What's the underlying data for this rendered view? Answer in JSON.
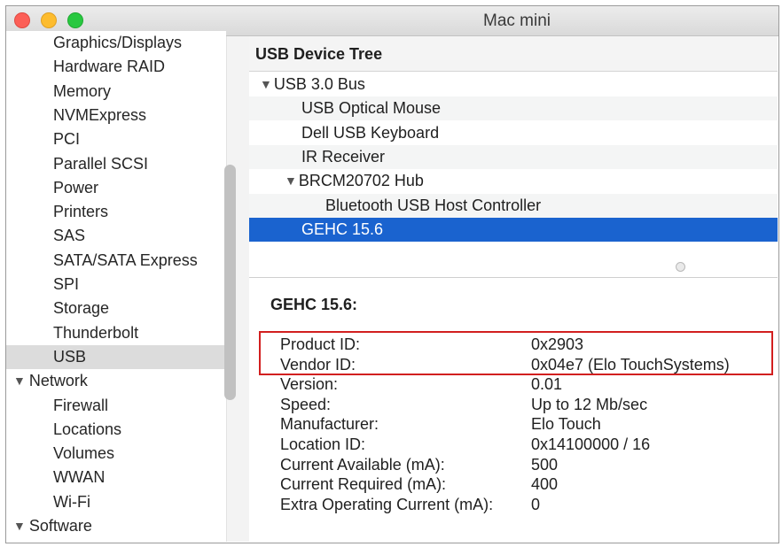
{
  "window": {
    "title": "Mac mini"
  },
  "sidebar": {
    "items": [
      {
        "label": "Graphics/Displays",
        "kind": "child"
      },
      {
        "label": "Hardware RAID",
        "kind": "child"
      },
      {
        "label": "Memory",
        "kind": "child"
      },
      {
        "label": "NVMExpress",
        "kind": "child"
      },
      {
        "label": "PCI",
        "kind": "child"
      },
      {
        "label": "Parallel SCSI",
        "kind": "child"
      },
      {
        "label": "Power",
        "kind": "child"
      },
      {
        "label": "Printers",
        "kind": "child"
      },
      {
        "label": "SAS",
        "kind": "child"
      },
      {
        "label": "SATA/SATA Express",
        "kind": "child"
      },
      {
        "label": "SPI",
        "kind": "child"
      },
      {
        "label": "Storage",
        "kind": "child"
      },
      {
        "label": "Thunderbolt",
        "kind": "child"
      },
      {
        "label": "USB",
        "kind": "child",
        "selected": true
      },
      {
        "label": "Network",
        "kind": "group"
      },
      {
        "label": "Firewall",
        "kind": "child"
      },
      {
        "label": "Locations",
        "kind": "child"
      },
      {
        "label": "Volumes",
        "kind": "child"
      },
      {
        "label": "WWAN",
        "kind": "child"
      },
      {
        "label": "Wi-Fi",
        "kind": "child"
      },
      {
        "label": "Software",
        "kind": "group"
      }
    ]
  },
  "tree": {
    "header": "USB Device Tree",
    "rows": [
      {
        "label": "USB 3.0 Bus",
        "expandable": true
      },
      {
        "label": "USB Optical Mouse"
      },
      {
        "label": "Dell USB Keyboard"
      },
      {
        "label": "IR Receiver"
      },
      {
        "label": "BRCM20702 Hub",
        "expandable": true
      },
      {
        "label": "Bluetooth USB Host Controller"
      },
      {
        "label": "GEHC 15.6",
        "selected": true
      }
    ]
  },
  "detail": {
    "title": "GEHC 15.6:",
    "properties": [
      {
        "label": "Product ID:",
        "value": "0x2903"
      },
      {
        "label": "Vendor ID:",
        "value": "0x04e7  (Elo TouchSystems)"
      },
      {
        "label": "Version:",
        "value": "0.01"
      },
      {
        "label": "Speed:",
        "value": "Up to 12 Mb/sec"
      },
      {
        "label": "Manufacturer:",
        "value": "Elo Touch"
      },
      {
        "label": "Location ID:",
        "value": "0x14100000 / 16"
      },
      {
        "label": "Current Available (mA):",
        "value": "500"
      },
      {
        "label": "Current Required (mA):",
        "value": "400"
      },
      {
        "label": "Extra Operating Current (mA):",
        "value": "0"
      }
    ]
  },
  "colors": {
    "selection_blue": "#1a63cf",
    "highlight_red": "#d21f1f",
    "sidebar_selected": "#dcdcdc"
  },
  "icons": {
    "disclosure": "disclosure-triangle-down-icon"
  }
}
